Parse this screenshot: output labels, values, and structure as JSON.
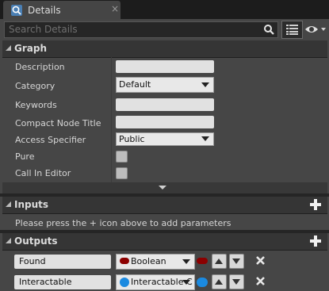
{
  "tab": {
    "title": "Details",
    "close": "×"
  },
  "search": {
    "placeholder": "Search Details"
  },
  "graph": {
    "title": "Graph",
    "labels": {
      "description": "Description",
      "category": "Category",
      "keywords": "Keywords",
      "compact_node_title": "Compact Node Title",
      "access_specifier": "Access Specifier",
      "pure": "Pure",
      "call_in_editor": "Call In Editor"
    },
    "values": {
      "category": "Default",
      "access_specifier": "Public"
    }
  },
  "inputs": {
    "title": "Inputs",
    "hint": "Please press the + icon above to add parameters"
  },
  "outputs": {
    "title": "Outputs",
    "params": [
      {
        "name": "Found",
        "type": "Boolean",
        "pin_color": "#8c0000"
      },
      {
        "name": "Interactable",
        "type": "Interactable Component",
        "pin_color": "#1b8ae0"
      }
    ]
  },
  "icons": {
    "tab": "details-magnifier-icon",
    "search": "search-icon",
    "view_options": "view-options-icon",
    "eye": "eye-icon",
    "expand_arrow": "expand-arrow-icon",
    "add": "plus-icon",
    "move_up": "arrow-up-icon",
    "move_down": "arrow-down-icon",
    "remove": "close-icon"
  },
  "colors": {
    "background": "#464646",
    "header": "#353535",
    "field": "#e1e1e1",
    "boolean_pin": "#8c0000",
    "object_pin": "#1b8ae0"
  }
}
